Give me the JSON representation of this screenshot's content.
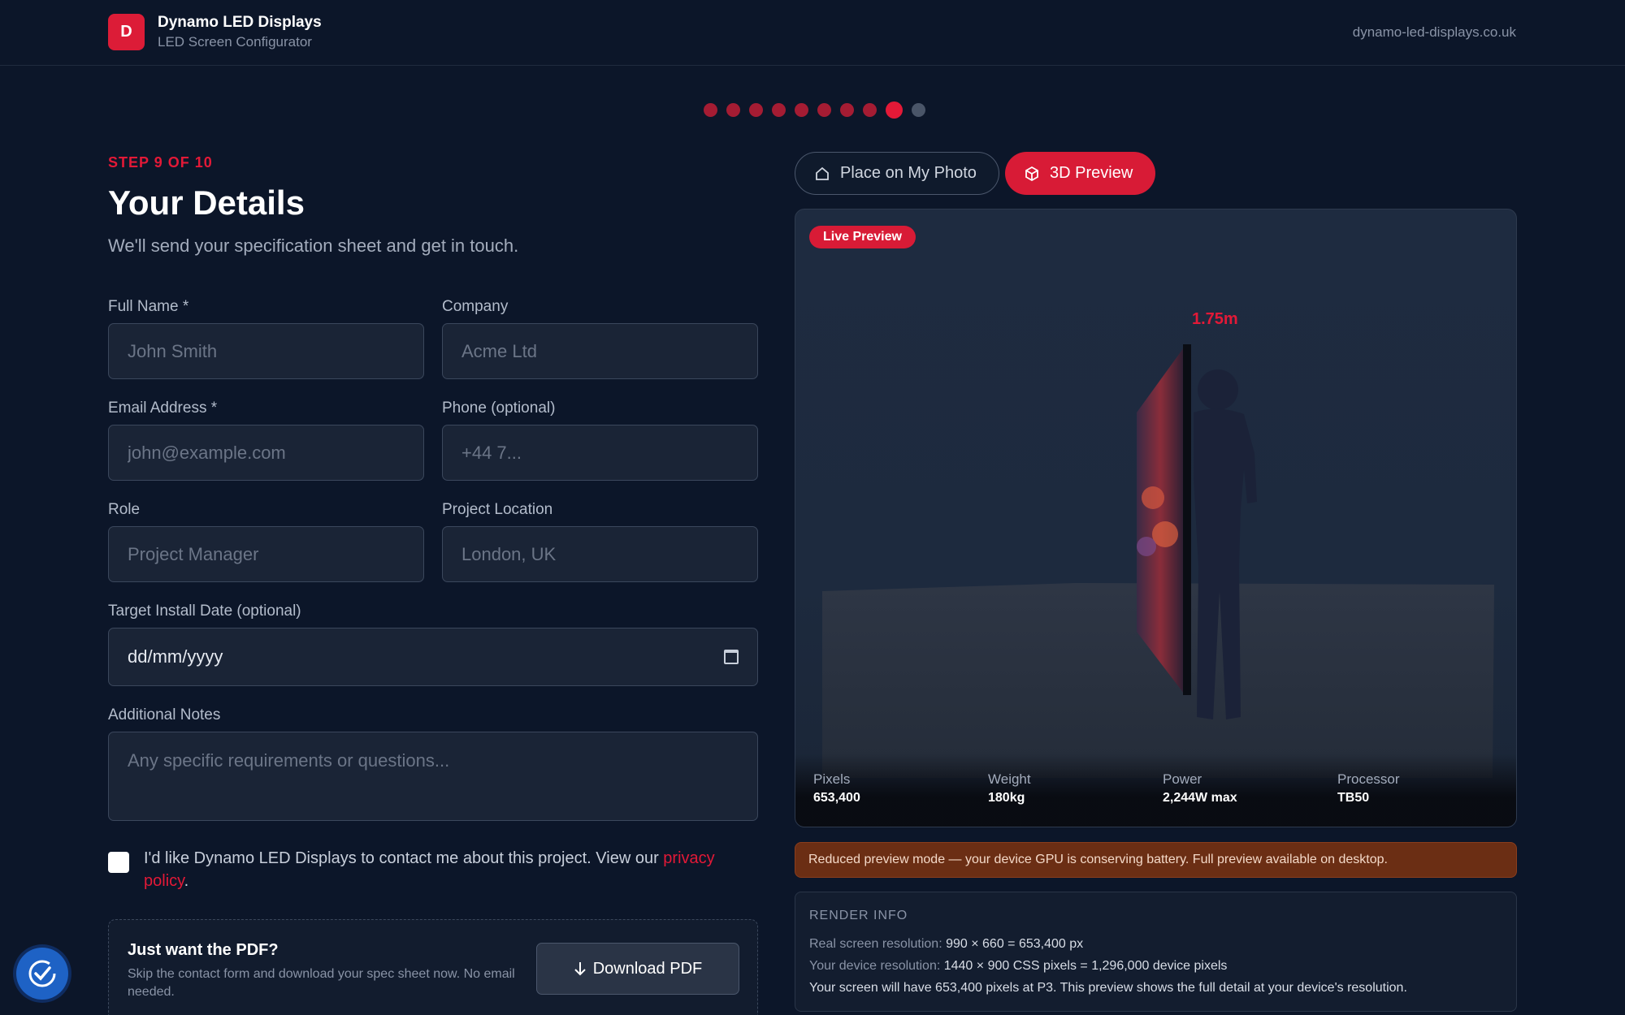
{
  "header": {
    "logo_letter": "D",
    "brand_name": "Dynamo LED Displays",
    "brand_sub": "LED Screen Configurator",
    "site_url": "dynamo-led-displays.co.uk",
    "accent_color": "#dc1c37"
  },
  "progress": {
    "current_step": 9,
    "total_steps": 10
  },
  "form": {
    "step_label": "STEP 9 OF 10",
    "title": "Your Details",
    "subtitle": "We'll send your specification sheet and get in touch.",
    "full_name": {
      "label": "Full Name *",
      "placeholder": "John Smith",
      "value": ""
    },
    "company": {
      "label": "Company",
      "placeholder": "Acme Ltd",
      "value": ""
    },
    "email": {
      "label": "Email Address *",
      "placeholder": "john@example.com",
      "value": ""
    },
    "phone": {
      "label": "Phone (optional)",
      "placeholder": "+44 7...",
      "value": ""
    },
    "role": {
      "label": "Role",
      "placeholder": "Project Manager",
      "value": ""
    },
    "location": {
      "label": "Project Location",
      "placeholder": "London, UK",
      "value": ""
    },
    "install_date": {
      "label": "Target Install Date (optional)",
      "placeholder": "dd/mm/yyyy"
    },
    "notes": {
      "label": "Additional Notes",
      "placeholder": "Any specific requirements or questions..."
    },
    "consent": {
      "checked": false,
      "text": "I'd like Dynamo LED Displays to contact me about this project. View our ",
      "link": "privacy policy",
      "after": "."
    }
  },
  "pdf": {
    "title": "Just want the PDF?",
    "description": "Skip the contact form and download your spec sheet now. No email needed.",
    "button": "Download PDF",
    "button_icon": "arrow-down-icon"
  },
  "preview": {
    "tabs": [
      {
        "label": "Place on My Photo",
        "icon": "home-icon",
        "active": false
      },
      {
        "label": "3D Preview",
        "icon": "cube-icon",
        "active": true
      }
    ],
    "badge": "Live Preview",
    "height_label": "1.75m",
    "stats": [
      {
        "label": "Pixels",
        "value": "653,400"
      },
      {
        "label": "Weight",
        "value": "180kg"
      },
      {
        "label": "Power",
        "value": "2,244W max"
      },
      {
        "label": "Processor",
        "value": "TB50"
      }
    ]
  },
  "warning": "Reduced preview mode — your device GPU is conserving battery. Full preview available on desktop.",
  "render_info": {
    "title": "RENDER INFO",
    "lines": [
      {
        "label": "Real screen resolution: ",
        "value": "990 × 660 = 653,400 px"
      },
      {
        "label": "Your device resolution: ",
        "value": "1440 × 900 CSS pixels = 1,296,000 device pixels"
      },
      {
        "label": "",
        "value": "Your screen will have 653,400 pixels at P3. This preview shows the full detail at your device's resolution."
      }
    ]
  }
}
